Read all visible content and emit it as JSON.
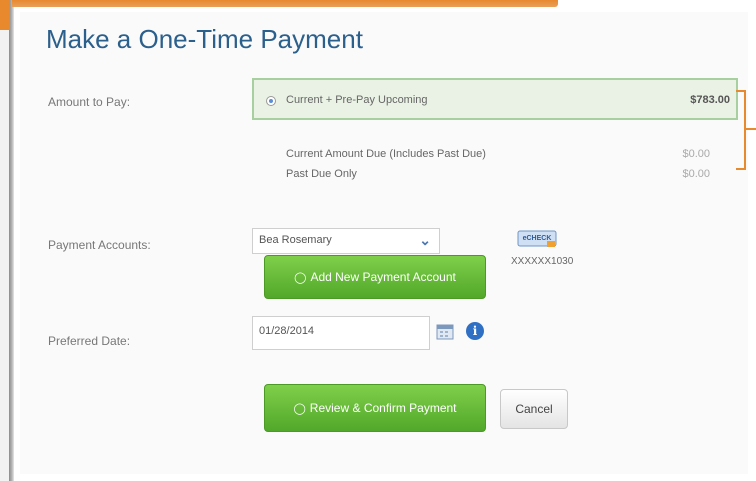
{
  "page": {
    "title": "Make a One-Time Payment"
  },
  "amount": {
    "label": "Amount to Pay:",
    "options": [
      {
        "text": "Current + Pre-Pay Upcoming",
        "amount": "$783.00",
        "selected": true
      },
      {
        "text": "Current Amount Due (Includes Past Due)",
        "amount": "$0.00",
        "selected": false
      },
      {
        "text": "Past Due Only",
        "amount": "$0.00",
        "selected": false
      }
    ]
  },
  "payment_accounts": {
    "label": "Payment Accounts:",
    "selected": "Bea Rosemary",
    "account_type_icon": "echeck-icon",
    "account_type_text": "eCHECK",
    "account_number": "XXXXXX1030",
    "add_button": "Add New Payment Account"
  },
  "date": {
    "label": "Preferred Date:",
    "value": "01/28/2014"
  },
  "actions": {
    "review_button": "Review & Confirm Payment",
    "cancel_button": "Cancel"
  },
  "colors": {
    "accent_orange": "#e8892e",
    "title_blue": "#2b5f8c",
    "button_green": "#62b832",
    "selected_bg": "#e9f2e4"
  }
}
